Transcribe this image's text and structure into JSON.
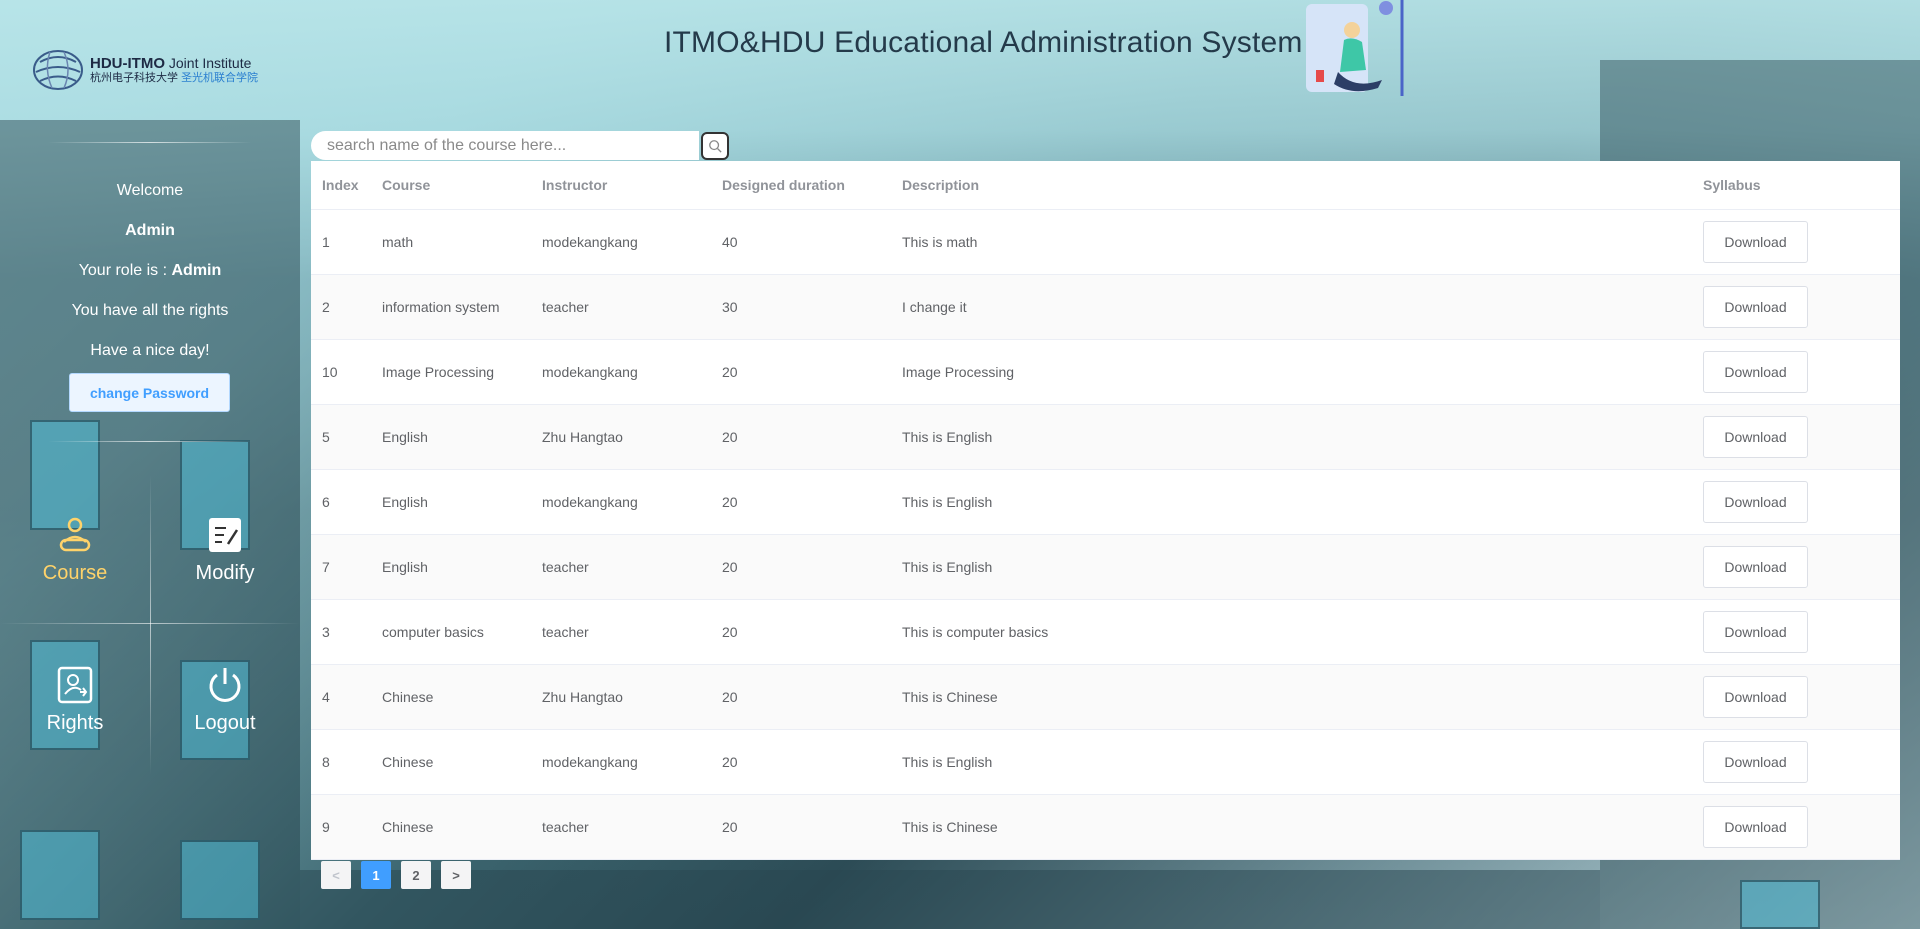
{
  "header": {
    "title": "ITMO&HDU Educational Administration System",
    "logo": {
      "brand_bold": "HDU-ITMO",
      "brand_rest": "Joint Institute",
      "chinese_black": "杭州电子科技大学",
      "chinese_blue": "圣光机联合学院"
    }
  },
  "sidebar": {
    "welcome": "Welcome",
    "username": "Admin",
    "role_prefix": "Your role is :",
    "role": "Admin",
    "rights_text": "You have all the rights",
    "greeting": "Have a nice day!",
    "change_password_label": "change Password",
    "nav": {
      "course": "Course",
      "modify": "Modify",
      "rights": "Rights",
      "logout": "Logout"
    }
  },
  "search": {
    "placeholder": "search name of the course here...",
    "value": ""
  },
  "table": {
    "columns": [
      "Index",
      "Course",
      "Instructor",
      "Designed duration",
      "Description",
      "Syllabus"
    ],
    "download_label": "Download",
    "rows": [
      {
        "index": "1",
        "course": "math",
        "instructor": "modekangkang",
        "duration": "40",
        "description": "This is math"
      },
      {
        "index": "2",
        "course": "information system",
        "instructor": "teacher",
        "duration": "30",
        "description": "I change it"
      },
      {
        "index": "10",
        "course": "Image Processing",
        "instructor": "modekangkang",
        "duration": "20",
        "description": "Image Processing"
      },
      {
        "index": "5",
        "course": "English",
        "instructor": "Zhu Hangtao",
        "duration": "20",
        "description": "This is English"
      },
      {
        "index": "6",
        "course": "English",
        "instructor": "modekangkang",
        "duration": "20",
        "description": "This is English"
      },
      {
        "index": "7",
        "course": "English",
        "instructor": "teacher",
        "duration": "20",
        "description": "This is English"
      },
      {
        "index": "3",
        "course": "computer basics",
        "instructor": "teacher",
        "duration": "20",
        "description": "This is computer basics"
      },
      {
        "index": "4",
        "course": "Chinese",
        "instructor": "Zhu Hangtao",
        "duration": "20",
        "description": "This is Chinese"
      },
      {
        "index": "8",
        "course": "Chinese",
        "instructor": "modekangkang",
        "duration": "20",
        "description": "This is English"
      },
      {
        "index": "9",
        "course": "Chinese",
        "instructor": "teacher",
        "duration": "20",
        "description": "This is Chinese"
      }
    ]
  },
  "pagination": {
    "prev": "<",
    "pages": [
      "1",
      "2"
    ],
    "current": "1",
    "next": ">"
  },
  "colors": {
    "accent": "#409eff",
    "active_nav": "#ffd36a"
  }
}
